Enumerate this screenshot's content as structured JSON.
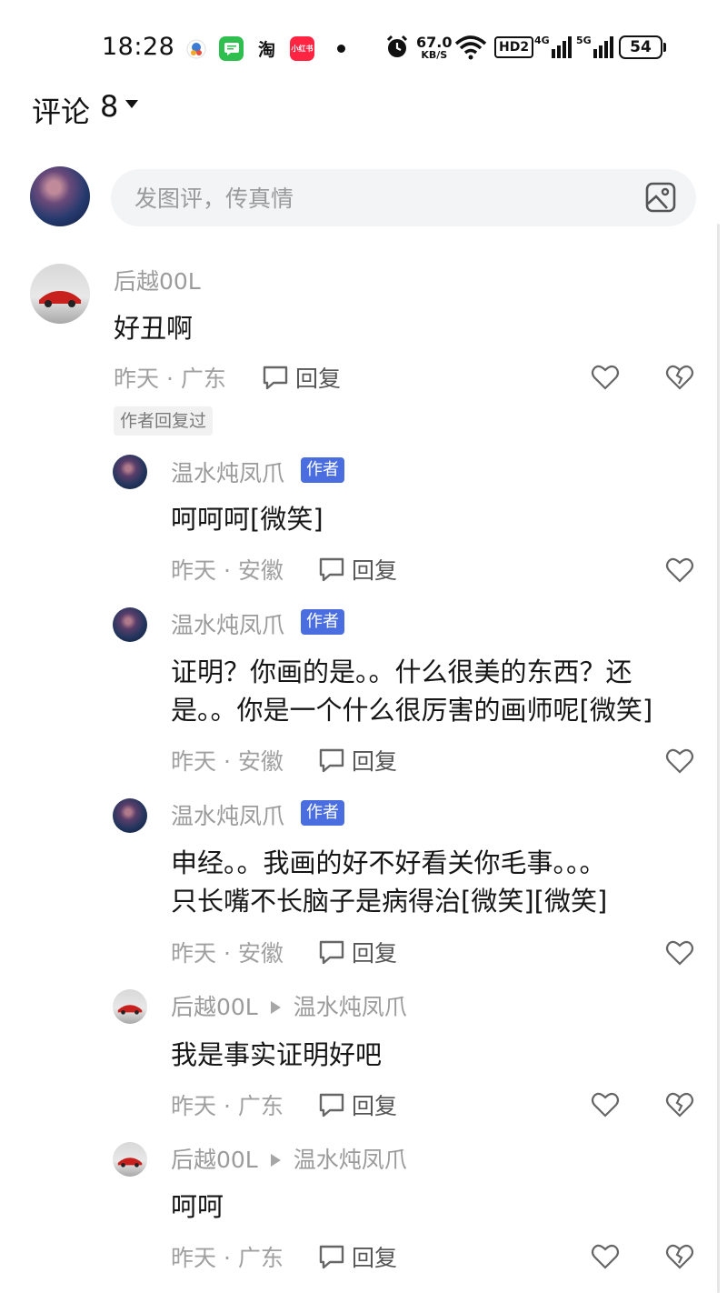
{
  "status_bar": {
    "time": "18:28",
    "apps": [
      {
        "icon": "baidu-app-icon",
        "color": "#ffffff"
      },
      {
        "icon": "messages-app-icon",
        "color": "#2fbf4f",
        "glyph": "▤"
      },
      {
        "icon": "taobao-app-icon",
        "color": "#ffffff",
        "glyph": "淘"
      },
      {
        "icon": "xiaohongshu-app-icon",
        "color": "#ff2442",
        "glyph": "小红书"
      }
    ],
    "speed_value": "67.0",
    "speed_unit": "KB/S",
    "hd_label": "HD2",
    "signal_4g": "4G",
    "signal_5g": "5G",
    "battery": "54"
  },
  "header": {
    "title": "评论",
    "count": "8"
  },
  "input": {
    "placeholder": "发图评，传真情"
  },
  "comments": [
    {
      "name": "后越00L",
      "text": "好丑啊",
      "meta": "昨天 · 广东",
      "reply": "回复",
      "badge": "作者回复过"
    },
    {
      "name": "温水炖凤爪",
      "author_badge": "作者",
      "text": "呵呵呵[微笑]",
      "meta": "昨天 · 安徽",
      "reply": "回复"
    },
    {
      "name": "温水炖凤爪",
      "author_badge": "作者",
      "text_lines": [
        "证明？你画的是。。什么很美的东西？还",
        "是。。你是一个什么很厉害的画师呢[微笑]"
      ],
      "meta": "昨天 · 安徽",
      "reply": "回复"
    },
    {
      "name": "温水炖凤爪",
      "author_badge": "作者",
      "text_lines": [
        "申经。。我画的好不好看关你毛事。。。",
        "只长嘴不长脑子是病得治[微笑][微笑]"
      ],
      "meta": "昨天 · 安徽",
      "reply": "回复"
    },
    {
      "name": "后越00L",
      "reply_to": "温水炖凤爪",
      "text": "我是事实证明好吧",
      "meta": "昨天 · 广东",
      "reply": "回复"
    },
    {
      "name": "后越00L",
      "reply_to": "温水炖凤爪",
      "text": "呵呵",
      "meta": "昨天 · 广东",
      "reply": "回复"
    }
  ]
}
